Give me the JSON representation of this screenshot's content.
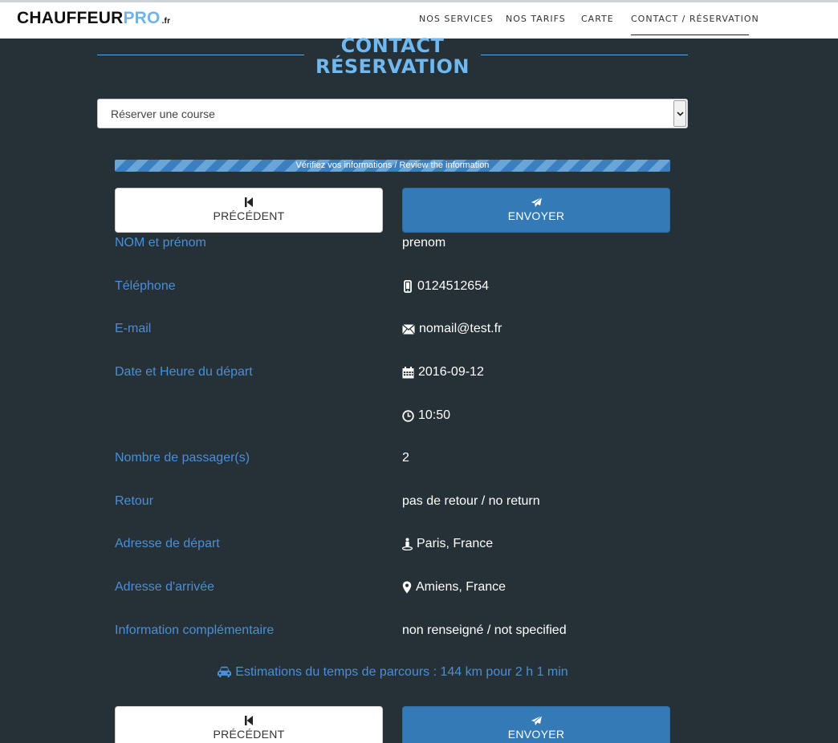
{
  "brand": {
    "part1": "CHAUFFEUR",
    "part2": "PRO",
    "part3": ".fr"
  },
  "nav": [
    {
      "label": "NOS SERVICES"
    },
    {
      "label": "NOS TARIFS"
    },
    {
      "label": "CARTE"
    },
    {
      "label": "CONTACT / RÉSERVATION",
      "active": true
    }
  ],
  "heading": {
    "line1": "CONTACT",
    "line2": "RÉSERVATION"
  },
  "select": {
    "value": "Réserver une course"
  },
  "progress": {
    "label": "Vérifiez vos informations / Review the information",
    "percent": 100
  },
  "buttons": {
    "previous": "PRÉCÉDENT",
    "send": "ENVOYER"
  },
  "fields": {
    "name": {
      "label": "NOM et prénom",
      "value": "prenom"
    },
    "phone": {
      "label": "Téléphone",
      "value": "0124512654",
      "icon": "mobile-icon"
    },
    "email": {
      "label": "E-mail",
      "value": "nomail@test.fr",
      "icon": "envelope-icon"
    },
    "departure": {
      "label": "Date et Heure du départ",
      "date": "2016-09-12",
      "time": "10:50",
      "date_icon": "calendar-icon",
      "time_icon": "clock-icon"
    },
    "passengers": {
      "label": "Nombre de passager(s)",
      "value": "2"
    },
    "return": {
      "label": "Retour",
      "value": "pas de retour / no return"
    },
    "from": {
      "label": "Adresse de départ",
      "value": "Paris, France",
      "icon": "street-view-icon"
    },
    "to": {
      "label": "Adresse d'arrivée",
      "value": "Amiens, France",
      "icon": "map-marker-icon"
    },
    "info": {
      "label": "Information complémentaire",
      "value": "non renseigné / not specified"
    }
  },
  "estimate": {
    "text": "Estimations du temps de parcours : 144 km pour 2 h 1 min",
    "icon": "car-icon"
  },
  "colors": {
    "background": "#263037",
    "accent": "#4a8fd6",
    "heading": "#6fb8f0",
    "button_primary": "#337ab7"
  }
}
